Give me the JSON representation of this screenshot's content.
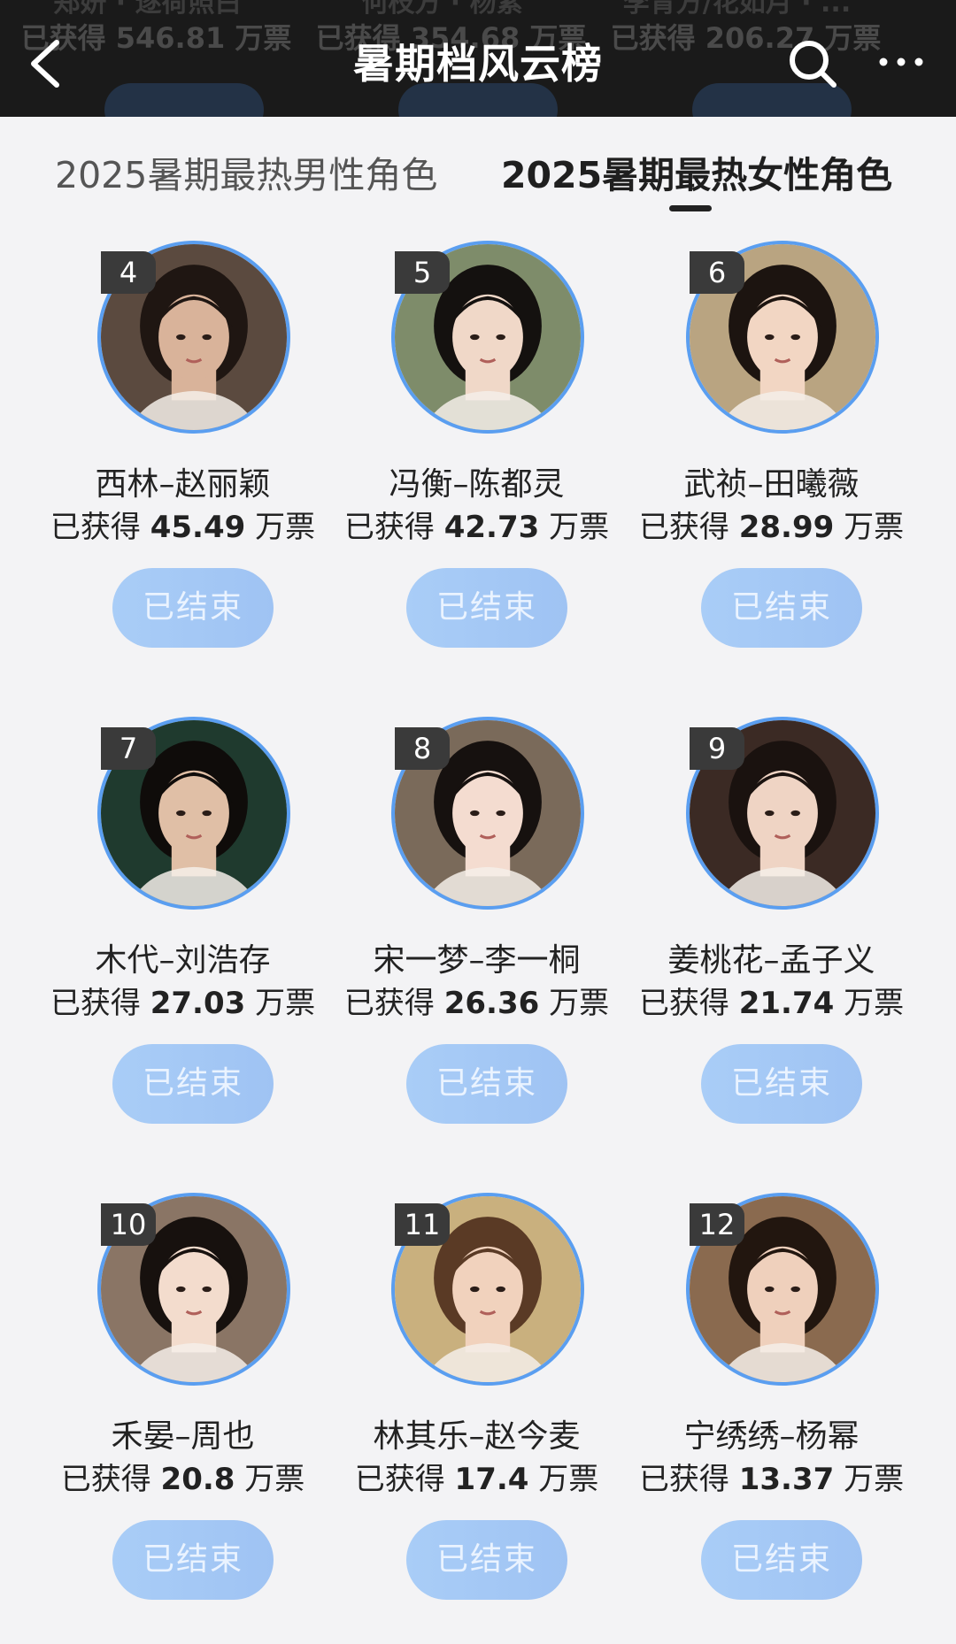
{
  "header": {
    "title": "暑期档风云榜",
    "ghost_row": [
      {
        "top": "郑妍 · 逐荷照白",
        "votes": "已获得 546.81 万票"
      },
      {
        "top": "何枝方 · 杨紫",
        "votes": "已获得 354.68 万票"
      },
      {
        "top": "李青方/花如月 · ...",
        "votes": "已获得 206.27 万票"
      }
    ]
  },
  "tabs": {
    "male": "2025暑期最热男性角色",
    "female": "2025暑期最热女性角色",
    "active": "female"
  },
  "colors": {
    "accent_ring": "#5a9ef0",
    "button_bg": "#a9cdf7",
    "header_bg": "#1a1a1a"
  },
  "cards": [
    {
      "rank": "4",
      "name": "西林–赵丽颖",
      "votes_prefix": "已获得",
      "votes": "45.49",
      "votes_unit": "万票",
      "button": "已结束",
      "avatar": {
        "bg": "#5b4a3f",
        "skin": "#d9b39a",
        "hair": "#1f1612"
      }
    },
    {
      "rank": "5",
      "name": "冯衡–陈都灵",
      "votes_prefix": "已获得",
      "votes": "42.73",
      "votes_unit": "万票",
      "button": "已结束",
      "avatar": {
        "bg": "#7e8c6a",
        "skin": "#f0d8c8",
        "hair": "#14110f"
      }
    },
    {
      "rank": "6",
      "name": "武祯–田曦薇",
      "votes_prefix": "已获得",
      "votes": "28.99",
      "votes_unit": "万票",
      "button": "已结束",
      "avatar": {
        "bg": "#b9a481",
        "skin": "#f2d6c3",
        "hair": "#1c1410"
      }
    },
    {
      "rank": "7",
      "name": "木代–刘浩存",
      "votes_prefix": "已获得",
      "votes": "27.03",
      "votes_unit": "万票",
      "button": "已结束",
      "avatar": {
        "bg": "#1f3a2e",
        "skin": "#e0bfa6",
        "hair": "#0f0c0a"
      }
    },
    {
      "rank": "8",
      "name": "宋一梦–李一桐",
      "votes_prefix": "已获得",
      "votes": "26.36",
      "votes_unit": "万票",
      "button": "已结束",
      "avatar": {
        "bg": "#7a6a5a",
        "skin": "#f4dcd0",
        "hair": "#16110f"
      }
    },
    {
      "rank": "9",
      "name": "姜桃花–孟子义",
      "votes_prefix": "已获得",
      "votes": "21.74",
      "votes_unit": "万票",
      "button": "已结束",
      "avatar": {
        "bg": "#3b2a24",
        "skin": "#efd4c4",
        "hair": "#1a120f"
      }
    },
    {
      "rank": "10",
      "name": "禾晏–周也",
      "votes_prefix": "已获得",
      "votes": "20.8",
      "votes_unit": "万票",
      "button": "已结束",
      "avatar": {
        "bg": "#8a7565",
        "skin": "#f3dccd",
        "hair": "#17110e"
      }
    },
    {
      "rank": "11",
      "name": "林其乐–赵今麦",
      "votes_prefix": "已获得",
      "votes": "17.4",
      "votes_unit": "万票",
      "button": "已结束",
      "avatar": {
        "bg": "#c9b07e",
        "skin": "#f1d2bd",
        "hair": "#5a3a25"
      }
    },
    {
      "rank": "12",
      "name": "宁绣绣–杨幂",
      "votes_prefix": "已获得",
      "votes": "13.37",
      "votes_unit": "万票",
      "button": "已结束",
      "avatar": {
        "bg": "#8a6a4f",
        "skin": "#efd0bc",
        "hair": "#22160f"
      }
    }
  ],
  "icons": {
    "back": "back-arrow-icon",
    "search": "search-icon",
    "more": "more-dots-icon"
  }
}
